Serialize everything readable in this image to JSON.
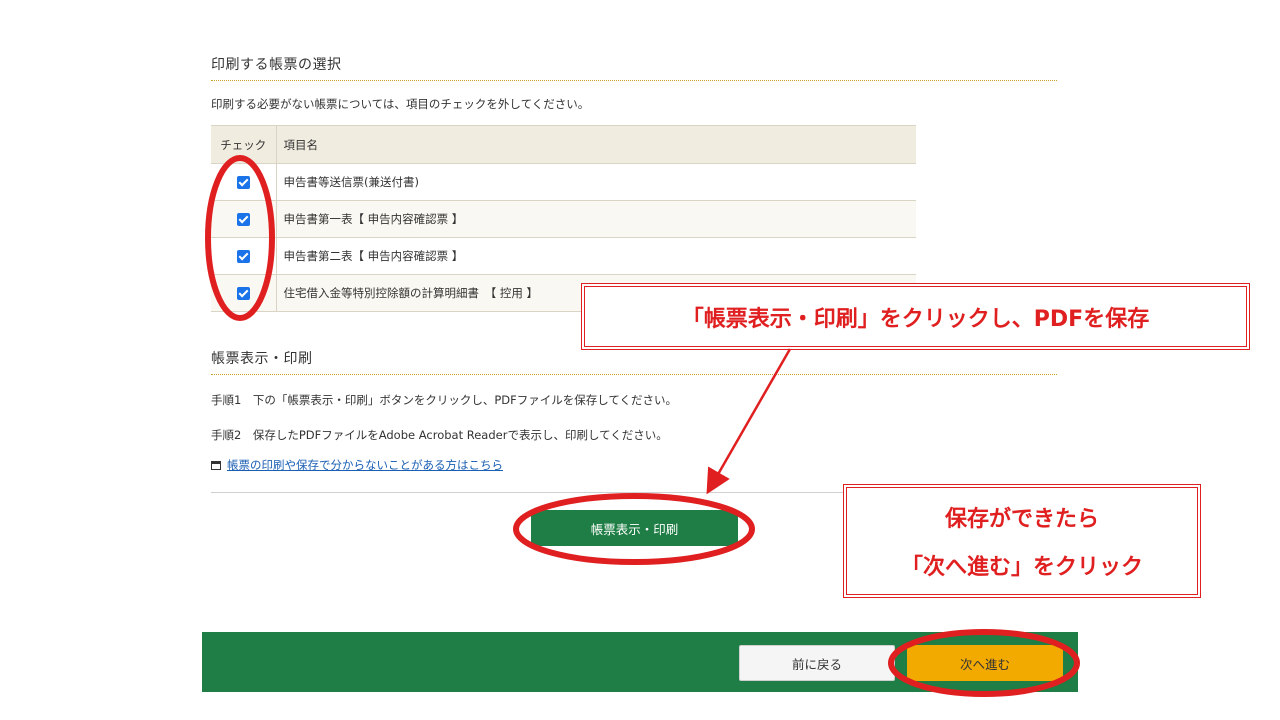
{
  "select_section": {
    "title": "印刷する帳票の選択",
    "note": "印刷する必要がない帳票については、項目のチェックを外してください。",
    "table": {
      "headers": [
        "チェック",
        "項目名"
      ],
      "rows": [
        {
          "checked": true,
          "name": "申告書等送信票(兼送付書)"
        },
        {
          "checked": true,
          "name": "申告書第一表【 申告内容確認票 】"
        },
        {
          "checked": true,
          "name": "申告書第二表【 申告内容確認票 】"
        },
        {
          "checked": true,
          "name": "住宅借入金等特別控除額の計算明細書　【 控用 】"
        }
      ]
    }
  },
  "print_section": {
    "title": "帳票表示・印刷",
    "step1": "手順1　下の「帳票表示・印刷」ボタンをクリックし、PDFファイルを保存してください。",
    "step2": "手順2　保存したPDFファイルをAdobe Acrobat Readerで表示し、印刷してください。",
    "help_link": "帳票の印刷や保存で分からないことがある方はこちら",
    "print_button": "帳票表示・印刷"
  },
  "footer": {
    "back_button": "前に戻る",
    "next_button": "次へ進む"
  },
  "annotations": {
    "callout_print": "「帳票表示・印刷」をクリックし、PDFを保存",
    "callout_next_line1": "保存ができたら",
    "callout_next_line2": "「次へ進む」をクリック"
  },
  "colors": {
    "primary_green": "#1e7e45",
    "next_orange": "#f2a900",
    "annotation_red": "#e02020",
    "checkbox_blue": "#1a73e8"
  },
  "icons": {
    "help_link_icon": "window-icon",
    "checkbox": "checkmark-icon"
  }
}
